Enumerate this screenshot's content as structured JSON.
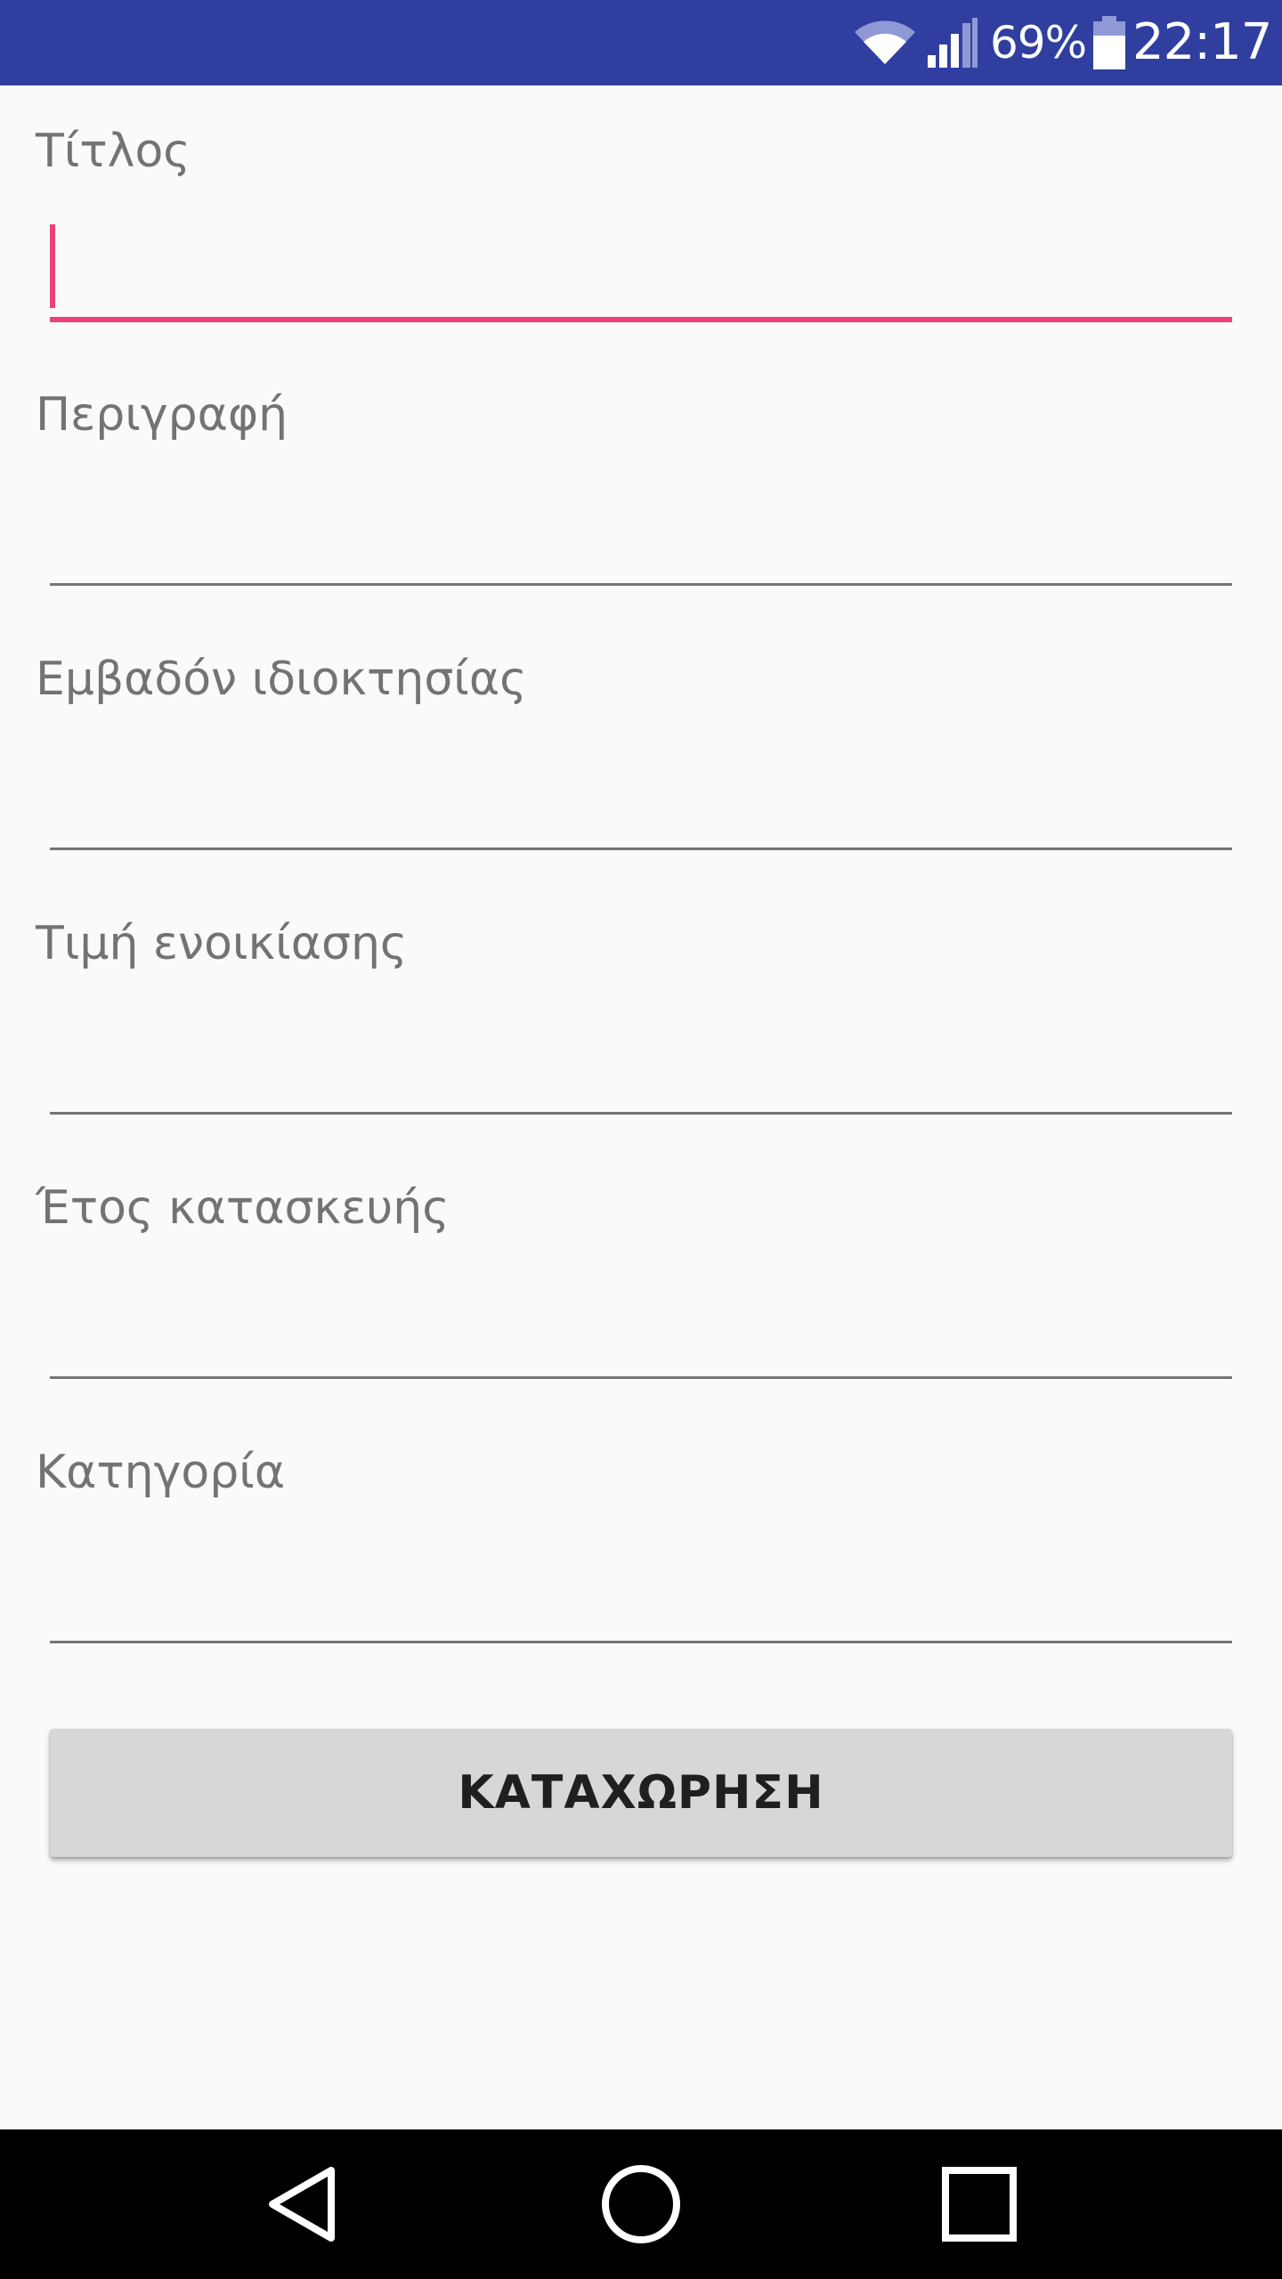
{
  "status_bar": {
    "battery_percent": "69%",
    "time": "22:17"
  },
  "form": {
    "fields": [
      {
        "label": "Τίτλος",
        "value": ""
      },
      {
        "label": "Περιγραφή",
        "value": ""
      },
      {
        "label": "Εμβαδόν ιδιοκτησίας",
        "value": ""
      },
      {
        "label": "Τιμή ενοικίασης",
        "value": ""
      },
      {
        "label": "Έτος κατασκευής",
        "value": ""
      },
      {
        "label": "Κατηγορία",
        "value": ""
      }
    ],
    "submit_label": "ΚΑΤΑΧΩΡΗΣΗ"
  },
  "colors": {
    "status_bar": "#303f9f",
    "accent": "#ec407a",
    "background": "#fafafa",
    "button": "#d6d7d7"
  }
}
